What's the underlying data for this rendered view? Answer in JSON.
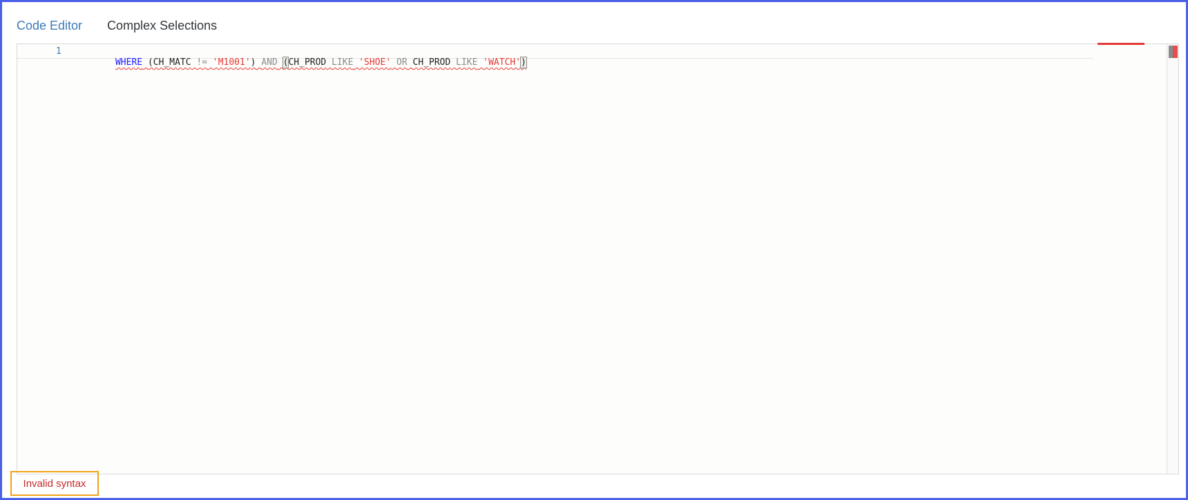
{
  "tabs": [
    {
      "label": "Code Editor",
      "active": true
    },
    {
      "label": "Complex Selections",
      "active": false
    }
  ],
  "editor": {
    "line_number": "1",
    "tokens": [
      {
        "text": "WHERE",
        "kind": "keyword-primary"
      },
      {
        "text": " ",
        "kind": "space"
      },
      {
        "text": "(CH_MATC",
        "kind": "identifier"
      },
      {
        "text": " ",
        "kind": "space"
      },
      {
        "text": "!=",
        "kind": "operator"
      },
      {
        "text": " ",
        "kind": "space"
      },
      {
        "text": "'M1001'",
        "kind": "string"
      },
      {
        "text": ")",
        "kind": "identifier"
      },
      {
        "text": " ",
        "kind": "space"
      },
      {
        "text": "AND",
        "kind": "keyword-secondary"
      },
      {
        "text": " ",
        "kind": "space"
      },
      {
        "text": "(",
        "kind": "paren-match"
      },
      {
        "text": "CH_PROD",
        "kind": "identifier"
      },
      {
        "text": " ",
        "kind": "space"
      },
      {
        "text": "LIKE",
        "kind": "keyword-secondary"
      },
      {
        "text": " ",
        "kind": "space"
      },
      {
        "text": "'SHOE'",
        "kind": "string"
      },
      {
        "text": " ",
        "kind": "space"
      },
      {
        "text": "OR",
        "kind": "keyword-secondary"
      },
      {
        "text": " ",
        "kind": "space"
      },
      {
        "text": "CH_PROD",
        "kind": "identifier"
      },
      {
        "text": " ",
        "kind": "space"
      },
      {
        "text": "LIKE",
        "kind": "keyword-secondary"
      },
      {
        "text": " ",
        "kind": "space"
      },
      {
        "text": "'WATCH'",
        "kind": "string"
      },
      {
        "text": ")",
        "kind": "paren-match"
      }
    ]
  },
  "status": {
    "message": "Invalid syntax"
  },
  "colors": {
    "frame_border": "#4a5ee8",
    "active_tab": "#3c7ab8",
    "keyword_primary": "#1a1aff",
    "keyword_secondary": "#8a8a8a",
    "string": "#e53935",
    "error": "#c62828",
    "status_border": "#f0a216"
  }
}
